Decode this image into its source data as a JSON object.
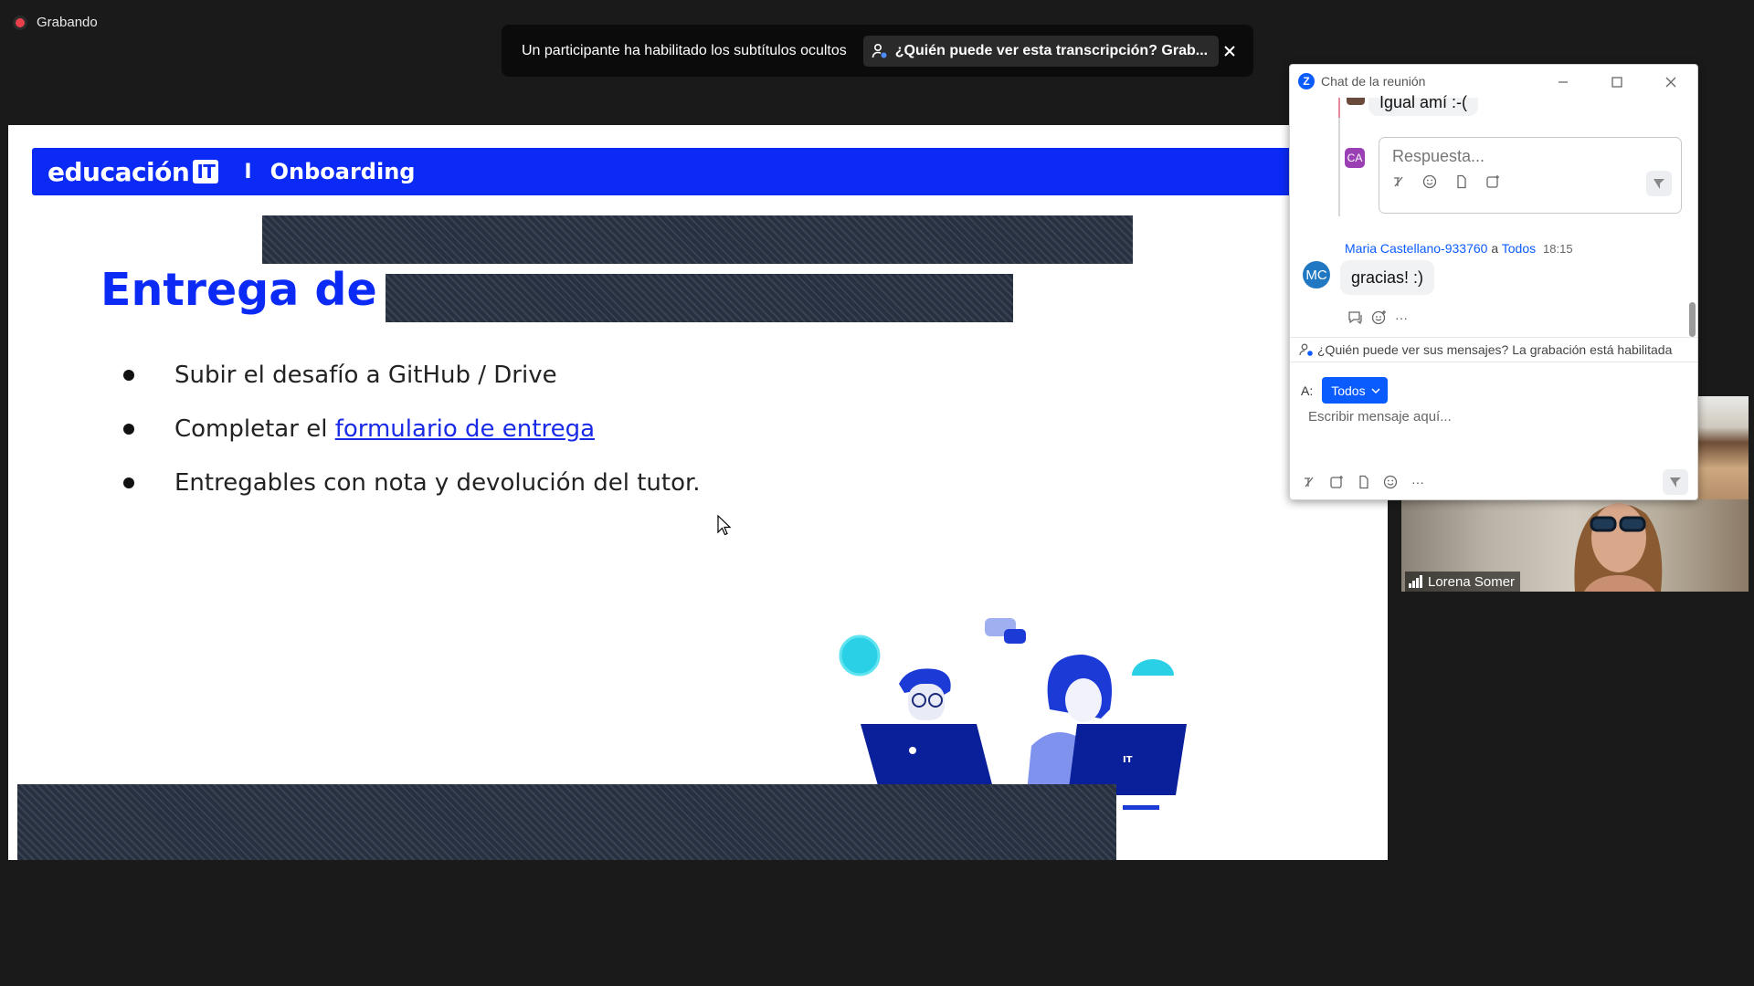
{
  "recording": {
    "label": "Grabando"
  },
  "notification": {
    "message": "Un participante ha habilitado los subtítulos ocultos",
    "transcript_prompt": "¿Quién puede ver esta transcripción? Grab...",
    "close_icon": "close-icon"
  },
  "slide": {
    "brand": "educación",
    "brand_badge": "IT",
    "separator": "I",
    "section": "Onboarding",
    "title_visible": "Entrega de a",
    "bullets": [
      {
        "text": "Subir el desafío a GitHub / Drive",
        "link": ""
      },
      {
        "text": "Completar el ",
        "link": "formulario de entrega"
      },
      {
        "text": "Entregables con nota y devolución del tutor.",
        "link": ""
      }
    ],
    "accent_color": "#0b2af5"
  },
  "chat": {
    "title": "Chat de la reunión",
    "prev_message": "Igual amí :-(",
    "reply_avatar": "CA",
    "reply_placeholder": "Respuesta...",
    "message": {
      "sender": "Maria Castellano-933760",
      "to_word": "a",
      "recipient": "Todos",
      "time": "18:15",
      "avatar": "MC",
      "text": "gracias! :)"
    },
    "more_label": "···",
    "privacy_notice": "¿Quién puede ver sus mensajes? La grabación está habilitada",
    "to_label": "A:",
    "to_value": "Todos",
    "input_placeholder": "Escribir mensaje aquí...",
    "brand_color": "#0b5cff"
  },
  "video": {
    "participant_name": "Lorena Somer"
  }
}
